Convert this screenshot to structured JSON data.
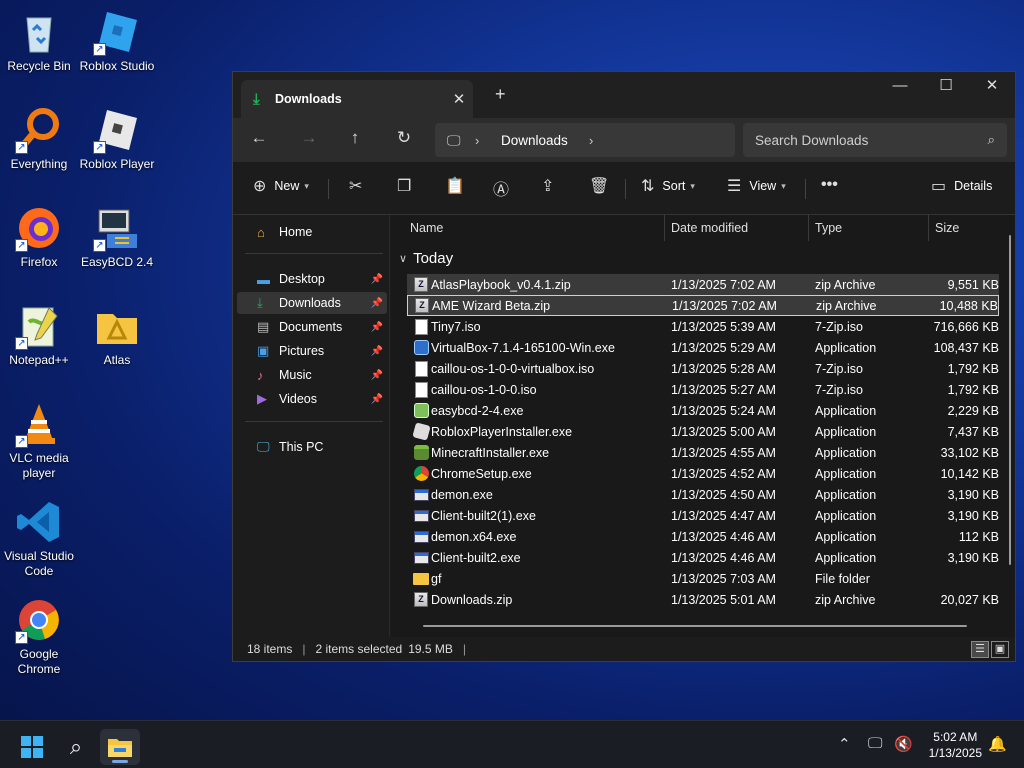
{
  "desktop": {
    "icons": [
      {
        "label": "Recycle Bin",
        "icon": "recycle-bin-icon"
      },
      {
        "label": "Roblox Studio",
        "icon": "roblox-studio-icon"
      },
      {
        "label": "Everything",
        "icon": "everything-search-icon"
      },
      {
        "label": "Roblox Player",
        "icon": "roblox-player-icon"
      },
      {
        "label": "Firefox",
        "icon": "firefox-icon"
      },
      {
        "label": "EasyBCD 2.4",
        "icon": "easybcd-icon"
      },
      {
        "label": "Notepad++",
        "icon": "notepadpp-icon"
      },
      {
        "label": "Atlas",
        "icon": "atlas-folder-icon"
      },
      {
        "label": "VLC media player",
        "icon": "vlc-icon"
      },
      {
        "label": "Visual Studio Code",
        "icon": "vscode-icon"
      },
      {
        "label": "Google Chrome",
        "icon": "chrome-icon"
      }
    ]
  },
  "window": {
    "tab_title": "Downloads",
    "address": {
      "location": "Downloads"
    },
    "search": {
      "placeholder": "Search Downloads"
    },
    "toolbar": {
      "new_label": "New",
      "sort_label": "Sort",
      "view_label": "View",
      "details_label": "Details"
    },
    "nav": {
      "home": "Home",
      "pinned": [
        "Desktop",
        "Downloads",
        "Documents",
        "Pictures",
        "Music",
        "Videos"
      ],
      "this_pc": "This PC"
    },
    "columns": {
      "name": "Name",
      "date": "Date modified",
      "type": "Type",
      "size": "Size"
    },
    "group": "Today",
    "files": [
      {
        "name": "AtlasPlaybook_v0.4.1.zip",
        "date": "1/13/2025 7:02 AM",
        "type": "zip Archive",
        "size": "9,551 KB",
        "icon": "zip-icon"
      },
      {
        "name": "AME Wizard Beta.zip",
        "date": "1/13/2025 7:02 AM",
        "type": "zip Archive",
        "size": "10,488 KB",
        "icon": "zip-icon"
      },
      {
        "name": "Tiny7.iso",
        "date": "1/13/2025 5:39 AM",
        "type": "7-Zip.iso",
        "size": "716,666 KB",
        "icon": "file-icon"
      },
      {
        "name": "VirtualBox-7.1.4-165100-Win.exe",
        "date": "1/13/2025 5:29 AM",
        "type": "Application",
        "size": "108,437 KB",
        "icon": "virtualbox-icon"
      },
      {
        "name": "caillou-os-1-0-0-virtualbox.iso",
        "date": "1/13/2025 5:28 AM",
        "type": "7-Zip.iso",
        "size": "1,792 KB",
        "icon": "file-icon"
      },
      {
        "name": "caillou-os-1-0-0.iso",
        "date": "1/13/2025 5:27 AM",
        "type": "7-Zip.iso",
        "size": "1,792 KB",
        "icon": "file-icon"
      },
      {
        "name": "easybcd-2-4.exe",
        "date": "1/13/2025 5:24 AM",
        "type": "Application",
        "size": "2,229 KB",
        "icon": "installer-icon"
      },
      {
        "name": "RobloxPlayerInstaller.exe",
        "date": "1/13/2025 5:00 AM",
        "type": "Application",
        "size": "7,437 KB",
        "icon": "roblox-icon"
      },
      {
        "name": "MinecraftInstaller.exe",
        "date": "1/13/2025 4:55 AM",
        "type": "Application",
        "size": "33,102 KB",
        "icon": "minecraft-icon"
      },
      {
        "name": "ChromeSetup.exe",
        "date": "1/13/2025 4:52 AM",
        "type": "Application",
        "size": "10,142 KB",
        "icon": "chrome-icon"
      },
      {
        "name": "demon.exe",
        "date": "1/13/2025 4:50 AM",
        "type": "Application",
        "size": "3,190 KB",
        "icon": "exe-icon"
      },
      {
        "name": "Client-built2(1).exe",
        "date": "1/13/2025 4:47 AM",
        "type": "Application",
        "size": "3,190 KB",
        "icon": "exe-icon"
      },
      {
        "name": "demon.x64.exe",
        "date": "1/13/2025 4:46 AM",
        "type": "Application",
        "size": "112 KB",
        "icon": "exe-icon"
      },
      {
        "name": "Client-built2.exe",
        "date": "1/13/2025 4:46 AM",
        "type": "Application",
        "size": "3,190 KB",
        "icon": "exe-icon"
      },
      {
        "name": "gf",
        "date": "1/13/2025 7:03 AM",
        "type": "File folder",
        "size": "",
        "icon": "folder-icon"
      },
      {
        "name": "Downloads.zip",
        "date": "1/13/2025 5:01 AM",
        "type": "zip Archive",
        "size": "20,027 KB",
        "icon": "zip-icon"
      }
    ],
    "status": {
      "items": "18 items",
      "selected": "2 items selected",
      "selected_size": "19.5 MB"
    }
  },
  "taskbar": {
    "time": "5:02 AM",
    "date": "1/13/2025"
  },
  "colors": {
    "accent_green": "#1fb35a",
    "selection": "#3a3a3a",
    "window_bg": "#1c1c1c"
  }
}
